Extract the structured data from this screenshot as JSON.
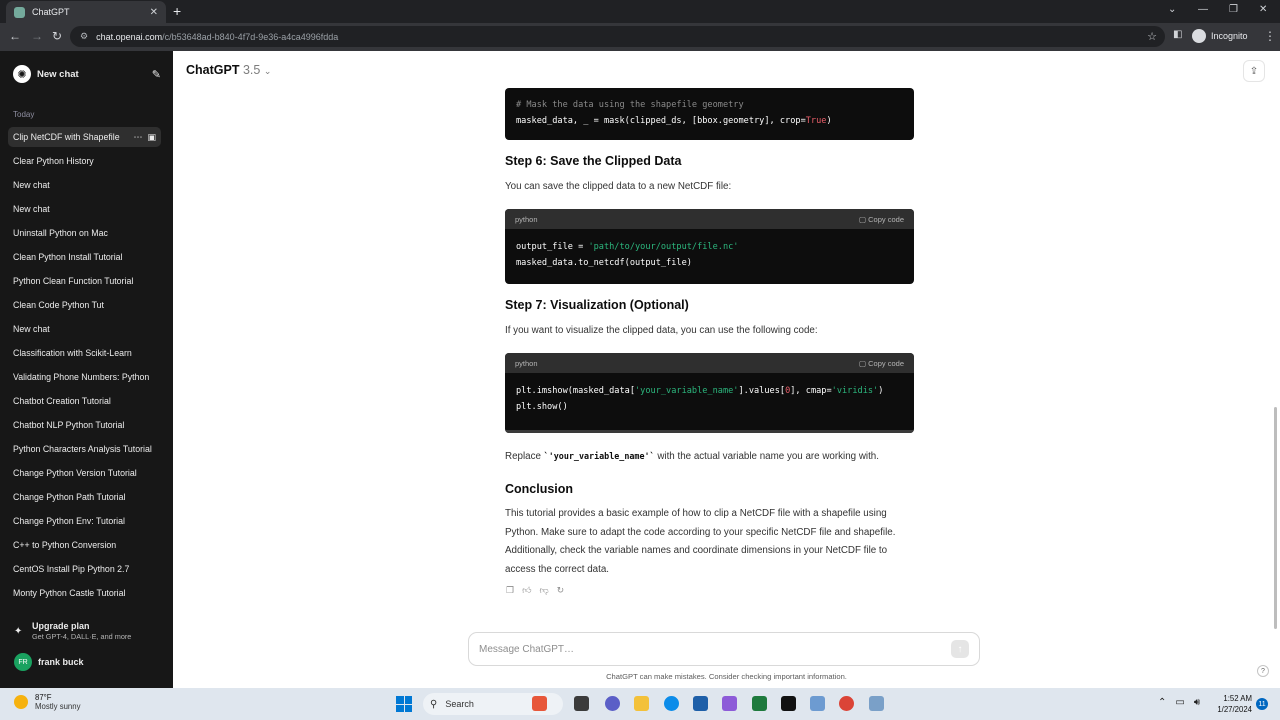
{
  "browser": {
    "tab_title": "ChatGPT",
    "tab_close": "✕",
    "new_tab": "+",
    "url_host": "chat.openai.com",
    "url_path": "/c/b53648ad-b840-4f7d-9e36-a4ca4996fdda",
    "profile": "Incognito"
  },
  "sidebar": {
    "new_chat": "New chat",
    "section": "Today",
    "items": [
      {
        "label": "Clip NetCDF with Shapefile"
      },
      {
        "label": "Clear Python History"
      },
      {
        "label": "New chat"
      },
      {
        "label": "New chat"
      },
      {
        "label": "Uninstall Python on Mac"
      },
      {
        "label": "Clean Python Install Tutorial"
      },
      {
        "label": "Python Clean Function Tutorial"
      },
      {
        "label": "Clean Code Python Tut"
      },
      {
        "label": "New chat"
      },
      {
        "label": "Classification with Scikit-Learn"
      },
      {
        "label": "Validating Phone Numbers: Python"
      },
      {
        "label": "Chatbot Creation Tutorial"
      },
      {
        "label": "Chatbot NLP Python Tutorial"
      },
      {
        "label": "Python Characters Analysis Tutorial"
      },
      {
        "label": "Change Python Version Tutorial"
      },
      {
        "label": "Change Python Path Tutorial"
      },
      {
        "label": "Change Python Env: Tutorial"
      },
      {
        "label": "C++ to Python Conversion"
      },
      {
        "label": "CentOS Install Pip Python 2.7"
      },
      {
        "label": "Monty Python Castle Tutorial"
      }
    ],
    "upgrade_title": "Upgrade plan",
    "upgrade_sub": "Get GPT-4, DALL·E, and more",
    "user_initials": "FR",
    "user_name": "frank buck"
  },
  "main": {
    "model": "ChatGPT",
    "model_version": "3.5",
    "code1": {
      "comment": "# Mask the data using the shapefile geometry",
      "line2_pre": "masked_data, _ = mask(clipped_ds, [bbox.geometry], crop=",
      "line2_kw": "True",
      "line2_post": ")"
    },
    "step6_heading": "Step 6: Save the Clipped Data",
    "step6_text": "You can save the clipped data to a new NetCDF file:",
    "code2": {
      "lang": "python",
      "copy": "Copy code",
      "line1_pre": "output_file = ",
      "line1_str": "'path/to/your/output/file.nc'",
      "line2": "masked_data.to_netcdf(output_file)"
    },
    "step7_heading": "Step 7: Visualization (Optional)",
    "step7_text": "If you want to visualize the clipped data, you can use the following code:",
    "code3": {
      "lang": "python",
      "copy": "Copy code",
      "line1_pre": "plt.imshow(masked_data[",
      "line1_str": "'your_variable_name'",
      "line1_mid": "].values[",
      "line1_num": "0",
      "line1_mid2": "], cmap=",
      "line1_str2": "'viridis'",
      "line1_post": ")",
      "line2": "plt.show()"
    },
    "replace_pre": "Replace ",
    "replace_code": "`'your_variable_name'`",
    "replace_post": " with the actual variable name you are working with.",
    "conclusion_heading": "Conclusion",
    "conclusion_text": "This tutorial provides a basic example of how to clip a NetCDF file with a shapefile using Python. Make sure to adapt the code according to your specific NetCDF file and shapefile. Additionally, check the variable names and coordinate dimensions in your NetCDF file to access the correct data.",
    "composer_placeholder": "Message ChatGPT…",
    "disclaimer": "ChatGPT can make mistakes. Consider checking important information.",
    "help": "?"
  },
  "taskbar": {
    "temp": "87°F",
    "weather": "Mostly sunny",
    "search": "Search",
    "time": "1:52 AM",
    "date": "1/27/2024",
    "notifications": "11"
  }
}
